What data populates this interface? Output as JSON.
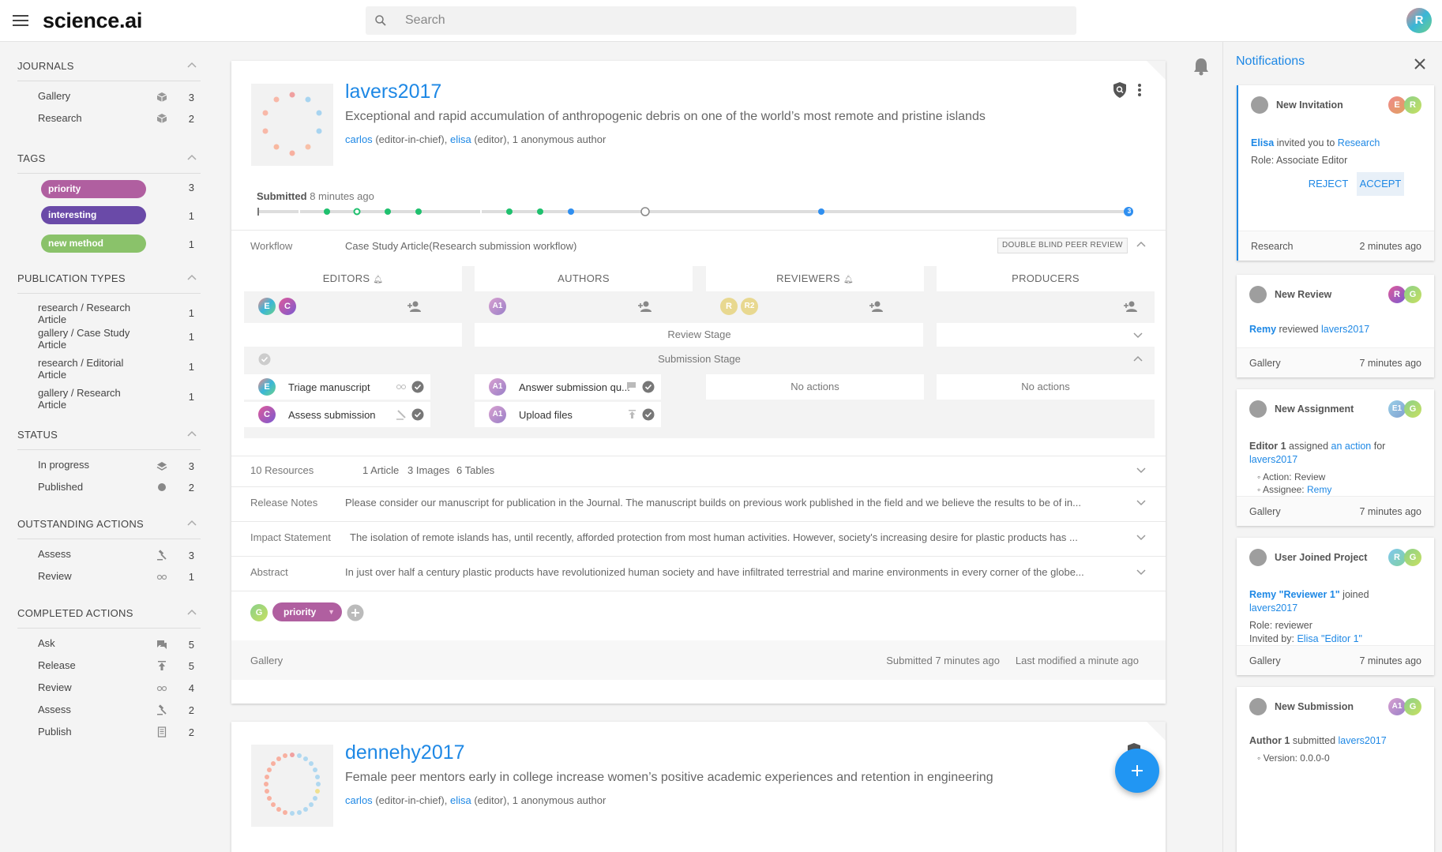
{
  "app": {
    "logo": "science.ai",
    "search_placeholder": "Search",
    "user_initial": "R"
  },
  "sidebar": {
    "journals": {
      "title": "JOURNALS",
      "items": [
        {
          "label": "Gallery",
          "count": "3"
        },
        {
          "label": "Research",
          "count": "2"
        }
      ]
    },
    "tags": {
      "title": "TAGS",
      "items": [
        {
          "label": "priority",
          "count": "3",
          "color": "#b05fa0"
        },
        {
          "label": "interesting",
          "count": "1",
          "color": "#6a4aa8"
        },
        {
          "label": "new method",
          "count": "1",
          "color": "#8ac26a"
        }
      ]
    },
    "pubtypes": {
      "title": "PUBLICATION TYPES",
      "items": [
        {
          "l1": "research / Research",
          "l2": "Article",
          "count": "1"
        },
        {
          "l1": "gallery / Case Study",
          "l2": "Article",
          "count": "1"
        },
        {
          "l1": "research / Editorial",
          "l2": "Article",
          "count": "1"
        },
        {
          "l1": "gallery / Research",
          "l2": "Article",
          "count": "1"
        }
      ]
    },
    "status": {
      "title": "STATUS",
      "items": [
        {
          "label": "In progress",
          "count": "3"
        },
        {
          "label": "Published",
          "count": "2"
        }
      ]
    },
    "outstanding": {
      "title": "OUTSTANDING ACTIONS",
      "items": [
        {
          "label": "Assess",
          "count": "3"
        },
        {
          "label": "Review",
          "count": "1"
        }
      ]
    },
    "completed": {
      "title": "COMPLETED ACTIONS",
      "items": [
        {
          "label": "Ask",
          "count": "5"
        },
        {
          "label": "Release",
          "count": "5"
        },
        {
          "label": "Review",
          "count": "4"
        },
        {
          "label": "Assess",
          "count": "2"
        },
        {
          "label": "Publish",
          "count": "2"
        }
      ]
    }
  },
  "card1": {
    "title": "lavers2017",
    "subtitle": "Exceptional and rapid accumulation of anthropogenic debris on one of the world’s most remote and pristine islands",
    "author1": "carlos",
    "role1": "(editor-in-chief),",
    "author2": "elisa",
    "role2": "(editor), 1 anonymous author",
    "submitted_label": "Submitted",
    "submitted_time": "8 minutes ago",
    "timeline_end": "3",
    "workflow_label": "Workflow",
    "workflow_value": "Case Study Article(Research submission workflow)",
    "workflow_badge": "DOUBLE BLIND PEER REVIEW",
    "columns": [
      "EDITORS",
      "AUTHORS",
      "REVIEWERS",
      "PRODUCERS"
    ],
    "review_stage": "Review Stage",
    "submission_stage": "Submission Stage",
    "actions": {
      "triage": "Triage manuscript",
      "assess": "Assess submission",
      "answer": "Answer submission qu...",
      "upload": "Upload files",
      "no_actions": "No actions"
    },
    "resources": {
      "label": "10 Resources",
      "articles": "1 Article",
      "images": "3 Images",
      "tables": "6 Tables"
    },
    "release_label": "Release Notes",
    "release_text": "Please consider our manuscript for publication in the Journal. The manuscript builds on previous work published in the field and we believe the results to be of in...",
    "impact_label": "Impact Statement",
    "impact_text": "The isolation of remote islands has, until recently, afforded protection from most human activities. However, society's increasing desire for plastic products has ...",
    "abstract_label": "Abstract",
    "abstract_text": "In just over half a century plastic products have revolutionized human society and have infiltrated terrestrial and marine environments in every corner of the globe...",
    "tag": "priority",
    "tag_avatar": "G",
    "footer_journal": "Gallery",
    "footer_submitted": "Submitted 7 minutes ago",
    "footer_modified": "Last modified a minute ago"
  },
  "card2": {
    "title": "dennehy2017",
    "subtitle": "Female peer mentors early in college increase women’s positive academic experiences and retention in engineering",
    "author1": "carlos",
    "role1": "(editor-in-chief),",
    "author2": "elisa",
    "role2": "(editor), 1 anonymous author"
  },
  "notifications": {
    "title": "Notifications",
    "n1": {
      "title": "New Invitation",
      "who": "Elisa",
      "text": " invited you to ",
      "target": "Research",
      "role": "Role: Associate Editor",
      "reject": "REJECT",
      "accept": "ACCEPT",
      "journal": "Research",
      "time": "2 minutes ago"
    },
    "n2": {
      "title": "New Review",
      "who": "Remy",
      "text": " reviewed ",
      "target": "lavers2017",
      "journal": "Gallery",
      "time": "7 minutes ago"
    },
    "n3": {
      "title": "New Assignment",
      "who": "Editor 1",
      "text": " assigned ",
      "target": "an action",
      "text2": " for",
      "target2": "lavers2017",
      "action": "Action: Review",
      "assignee_label": "Assignee: ",
      "assignee": "Remy",
      "journal": "Gallery",
      "time": "7 minutes ago"
    },
    "n4": {
      "title": "User Joined Project",
      "who": "Remy \"Reviewer 1\"",
      "text": " joined",
      "target": "lavers2017",
      "role": "Role: reviewer",
      "invited_label": "Invited by: ",
      "invited": "Elisa \"Editor 1\"",
      "journal": "Gallery",
      "time": "7 minutes ago"
    },
    "n5": {
      "title": "New Submission",
      "who": "Author 1",
      "text": " submitted ",
      "target": "lavers2017",
      "version": "Version: 0.0.0-0"
    }
  },
  "colors": {
    "accent": "#1e88e5",
    "fab": "#2196f3"
  }
}
